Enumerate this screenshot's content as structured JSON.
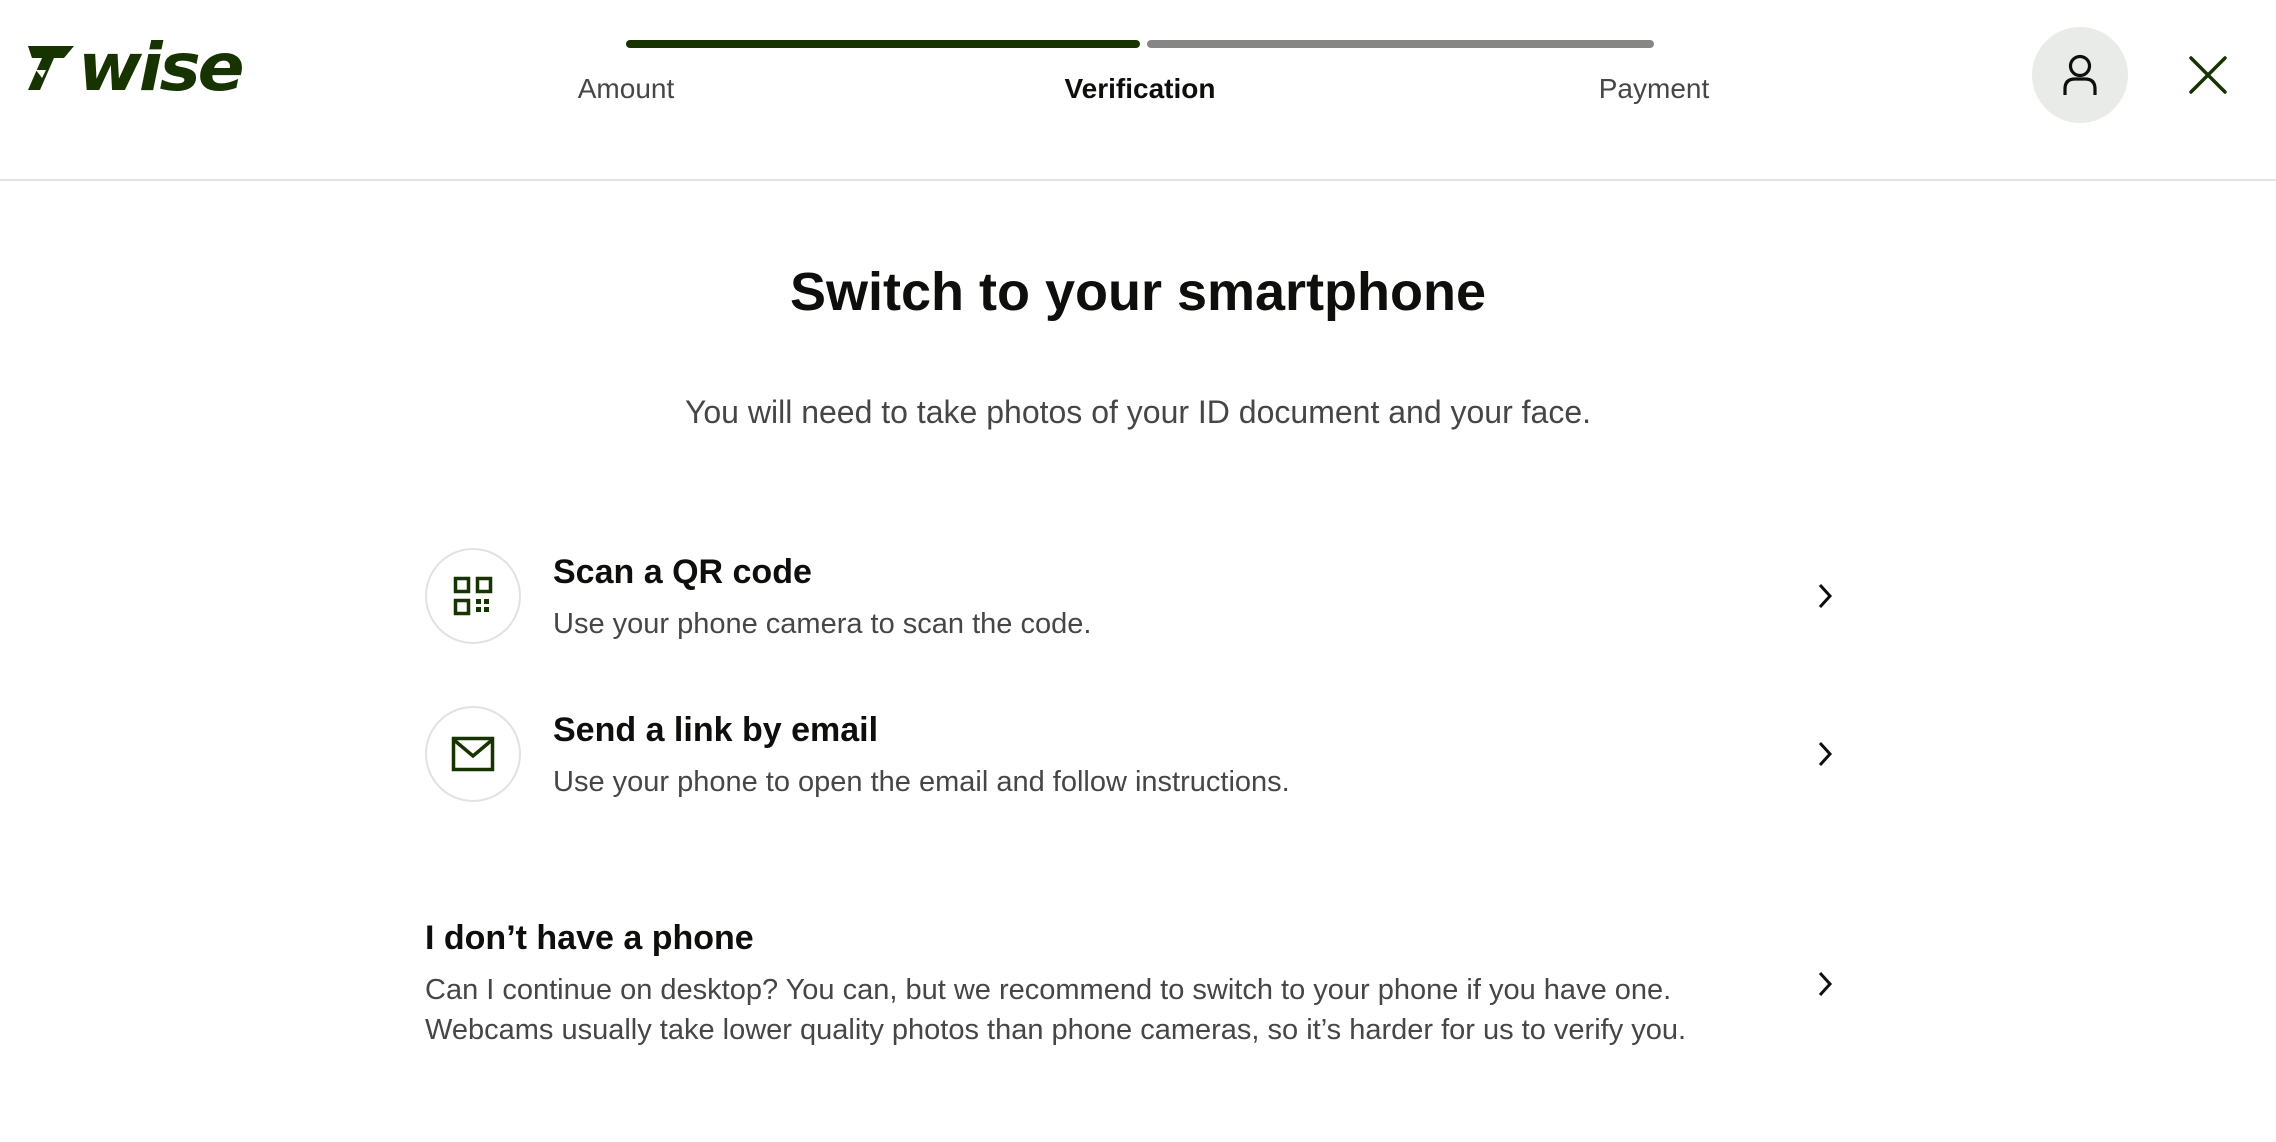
{
  "brand": {
    "name": "wise",
    "color": "#163300"
  },
  "progress": {
    "completed_fraction": 0.5,
    "steps": [
      {
        "label": "Amount",
        "state": "done"
      },
      {
        "label": "Verification",
        "state": "active"
      },
      {
        "label": "Payment",
        "state": "pending"
      }
    ]
  },
  "header": {
    "profile_icon": "person-icon",
    "close_icon": "close-icon"
  },
  "main": {
    "title": "Switch to your smartphone",
    "subtitle": "You will need to take photos of your ID document and your face.",
    "options": [
      {
        "icon": "qr-code-icon",
        "title": "Scan a QR code",
        "description": "Use your phone camera to scan the code."
      },
      {
        "icon": "envelope-icon",
        "title": "Send a link by email",
        "description": "Use your phone to open the email and follow instructions."
      }
    ],
    "no_phone": {
      "title": "I don’t have a phone",
      "description_line1": "Can I continue on desktop? You can, but we recommend to switch to your phone if you have one.",
      "description_line2": "Webcams usually take lower quality photos than phone cameras, so it’s harder for us to verify you."
    }
  },
  "colors": {
    "primary": "#163300",
    "progress_pending": "#868685",
    "text_secondary": "#454745",
    "icon_background": "#e9ebe8"
  }
}
